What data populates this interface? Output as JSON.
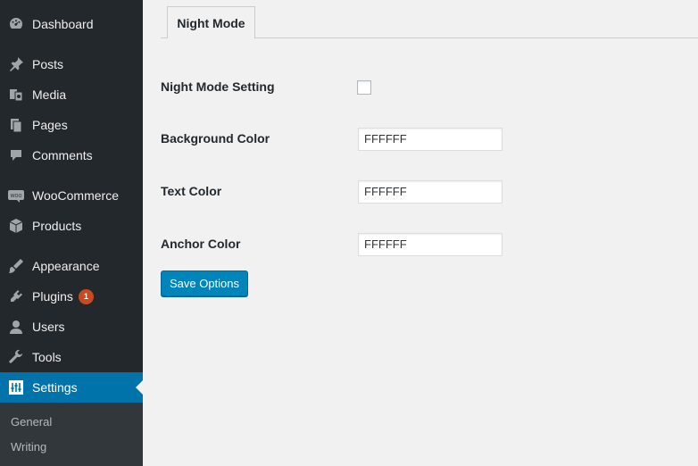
{
  "sidebar": {
    "items": [
      {
        "label": "Dashboard",
        "icon": "dashboard-icon"
      },
      {
        "label": "Posts",
        "icon": "pin-icon"
      },
      {
        "label": "Media",
        "icon": "media-icon"
      },
      {
        "label": "Pages",
        "icon": "pages-icon"
      },
      {
        "label": "Comments",
        "icon": "comment-icon"
      },
      {
        "label": "WooCommerce",
        "icon": "woocommerce-icon"
      },
      {
        "label": "Products",
        "icon": "box-icon"
      },
      {
        "label": "Appearance",
        "icon": "brush-icon"
      },
      {
        "label": "Plugins",
        "icon": "plug-icon",
        "badge": "1"
      },
      {
        "label": "Users",
        "icon": "user-icon"
      },
      {
        "label": "Tools",
        "icon": "wrench-icon"
      },
      {
        "label": "Settings",
        "icon": "settings-icon",
        "current": true
      }
    ],
    "submenu": [
      "General",
      "Writing"
    ]
  },
  "tab": {
    "label": "Night Mode"
  },
  "form": {
    "night_mode_label": "Night Mode Setting",
    "night_mode_checked": false,
    "bg_label": "Background Color",
    "bg_value": "FFFFFF",
    "text_label": "Text Color",
    "text_value": "FFFFFF",
    "anchor_label": "Anchor Color",
    "anchor_value": "FFFFFF",
    "save_label": "Save Options"
  },
  "colors": {
    "sidebar_bg": "#23282d",
    "accent": "#0073aa",
    "button": "#0085ba",
    "badge": "#ca4a1f"
  }
}
